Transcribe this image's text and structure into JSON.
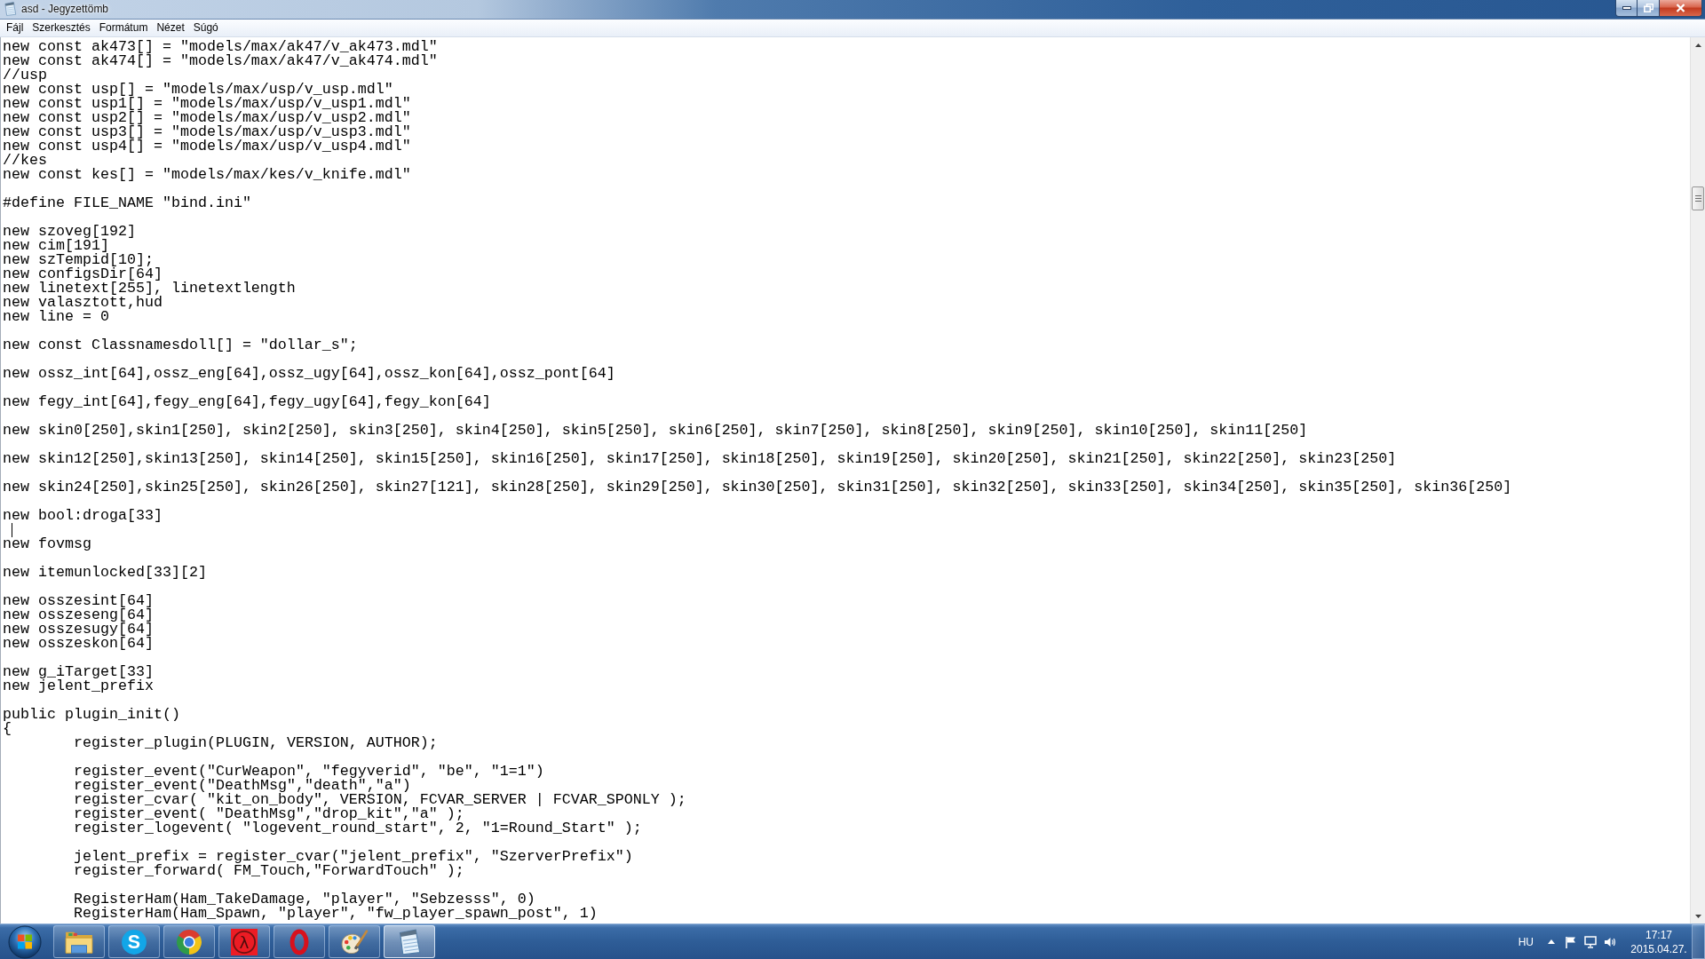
{
  "window": {
    "title": "asd - Jegyzettömb"
  },
  "menu": [
    "Fájl",
    "Szerkesztés",
    "Formátum",
    "Nézet",
    "Súgó"
  ],
  "editor": {
    "lines": [
      {
        "kind": "code",
        "text": "new const ak473[] = \"models/max/ak47/v_ak473.mdl\""
      },
      {
        "kind": "code",
        "text": "new const ak474[] = \"models/max/ak47/v_ak474.mdl\""
      },
      {
        "kind": "code",
        "text": "//usp"
      },
      {
        "kind": "code",
        "text": "new const usp[] = \"models/max/usp/v_usp.mdl\""
      },
      {
        "kind": "code",
        "text": "new const usp1[] = \"models/max/usp/v_usp1.mdl\""
      },
      {
        "kind": "code",
        "text": "new const usp2[] = \"models/max/usp/v_usp2.mdl\""
      },
      {
        "kind": "code",
        "text": "new const usp3[] = \"models/max/usp/v_usp3.mdl\""
      },
      {
        "kind": "code",
        "text": "new const usp4[] = \"models/max/usp/v_usp4.mdl\""
      },
      {
        "kind": "code",
        "text": "//kes"
      },
      {
        "kind": "code",
        "text": "new const kes[] = \"models/max/kes/v_knife.mdl\""
      },
      {
        "kind": "blank"
      },
      {
        "kind": "code",
        "text": "#define FILE_NAME \"bind.ini\""
      },
      {
        "kind": "blank"
      },
      {
        "kind": "code",
        "text": "new szoveg[192]"
      },
      {
        "kind": "code",
        "text": "new cim[191]"
      },
      {
        "kind": "code",
        "text": "new szTempid[10];"
      },
      {
        "kind": "code",
        "text": "new configsDir[64]"
      },
      {
        "kind": "code",
        "text": "new linetext[255], linetextlength"
      },
      {
        "kind": "code",
        "text": "new valasztott,hud"
      },
      {
        "kind": "code",
        "text": "new line = 0"
      },
      {
        "kind": "blank"
      },
      {
        "kind": "code",
        "text": "new const Classnamesdoll[] = \"dollar_s\";"
      },
      {
        "kind": "blank"
      },
      {
        "kind": "code",
        "text": "new ossz_int[64],ossz_eng[64],ossz_ugy[64],ossz_kon[64],ossz_pont[64]"
      },
      {
        "kind": "blank"
      },
      {
        "kind": "code",
        "text": "new fegy_int[64],fegy_eng[64],fegy_ugy[64],fegy_kon[64]"
      },
      {
        "kind": "blank"
      },
      {
        "kind": "code",
        "text": "new skin0[250],skin1[250], skin2[250], skin3[250], skin4[250], skin5[250], skin6[250], skin7[250], skin8[250], skin9[250], skin10[250], skin11[250]"
      },
      {
        "kind": "blank"
      },
      {
        "kind": "code",
        "text": "new skin12[250],skin13[250], skin14[250], skin15[250], skin16[250], skin17[250], skin18[250], skin19[250], skin20[250], skin21[250], skin22[250], skin23[250]"
      },
      {
        "kind": "blank"
      },
      {
        "kind": "code",
        "text": "new skin24[250],skin25[250], skin26[250], skin27[121], skin28[250], skin29[250], skin30[250], skin31[250], skin32[250], skin33[250], skin34[250], skin35[250], skin36[250]"
      },
      {
        "kind": "blank"
      },
      {
        "kind": "code",
        "text": "new bool:droga[33]"
      },
      {
        "kind": "caret"
      },
      {
        "kind": "code",
        "text": "new fovmsg"
      },
      {
        "kind": "blank"
      },
      {
        "kind": "code",
        "text": "new itemunlocked[33][2]"
      },
      {
        "kind": "blank"
      },
      {
        "kind": "code",
        "text": "new osszesint[64]"
      },
      {
        "kind": "code",
        "text": "new osszeseng[64]"
      },
      {
        "kind": "code",
        "text": "new osszesugy[64]"
      },
      {
        "kind": "code",
        "text": "new osszeskon[64]"
      },
      {
        "kind": "blank"
      },
      {
        "kind": "code",
        "text": "new g_iTarget[33]"
      },
      {
        "kind": "code",
        "text": "new jelent_prefix"
      },
      {
        "kind": "blank"
      },
      {
        "kind": "code",
        "text": "public plugin_init()"
      },
      {
        "kind": "code",
        "text": "{",
        "children": [
          {
            "kind": "code",
            "text": "register_plugin(PLUGIN, VERSION, AUTHOR);"
          },
          {
            "kind": "blank"
          },
          {
            "kind": "code",
            "text": "register_event(\"CurWeapon\", \"fegyverid\", \"be\", \"1=1\")"
          },
          {
            "kind": "code",
            "text": "register_event(\"DeathMsg\",\"death\",\"a\")"
          },
          {
            "kind": "code",
            "text": "register_cvar( \"kit_on_body\", VERSION, FCVAR_SERVER | FCVAR_SPONLY );"
          },
          {
            "kind": "code",
            "text": "register_event( \"DeathMsg\",\"drop_kit\",\"a\" );"
          },
          {
            "kind": "code",
            "text": "register_logevent( \"logevent_round_start\", 2, \"1=Round_Start\" );"
          },
          {
            "kind": "blank"
          },
          {
            "kind": "code",
            "text": "jelent_prefix = register_cvar(\"jelent_prefix\", \"SzerverPrefix\")"
          },
          {
            "kind": "code",
            "text": "register_forward( FM_Touch,\"ForwardTouch\" );"
          },
          {
            "kind": "blank"
          },
          {
            "kind": "code",
            "text": "RegisterHam(Ham_TakeDamage, \"player\", \"Sebzesss\", 0)"
          },
          {
            "kind": "code",
            "text": "RegisterHam(Ham_Spawn, \"player\", \"fw_player_spawn_post\", 1)"
          }
        ]
      }
    ]
  },
  "taskbar": {
    "apps": [
      {
        "kind": "explorer",
        "selected": false
      },
      {
        "kind": "skype",
        "glyph": "S",
        "selected": false
      },
      {
        "kind": "chrome",
        "selected": false
      },
      {
        "kind": "halflife",
        "glyph": "λ",
        "selected": false
      },
      {
        "kind": "opera",
        "selected": false
      },
      {
        "kind": "paint",
        "selected": false
      },
      {
        "kind": "notepad",
        "selected": true
      }
    ],
    "tray": {
      "language": "HU",
      "time": "17:17",
      "date": "2015.04.27."
    }
  }
}
